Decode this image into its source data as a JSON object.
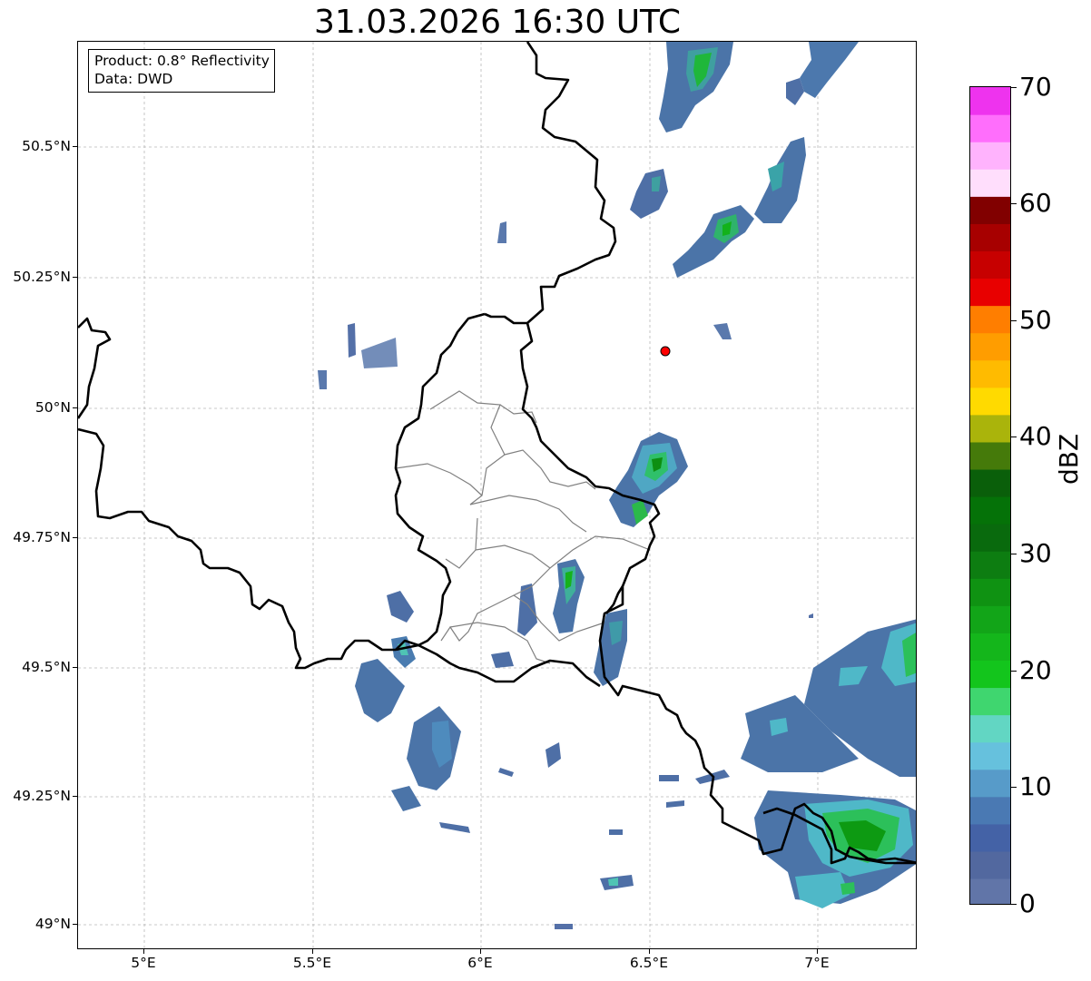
{
  "title": "31.03.2026 16:30 UTC",
  "info_box": {
    "product": "Product: 0.8° Reflectivity",
    "source": "Data: DWD"
  },
  "axes": {
    "lat_ticks": [
      "50.5°N",
      "50.25°N",
      "50°N",
      "49.75°N",
      "49.5°N",
      "49.25°N",
      "49°N"
    ],
    "lon_ticks": [
      "5°E",
      "5.5°E",
      "6°E",
      "6.5°E",
      "7°E"
    ]
  },
  "colorbar": {
    "unit": "dBZ",
    "tick_labels": [
      "0",
      "10",
      "20",
      "30",
      "40",
      "50",
      "60",
      "70"
    ],
    "colors": [
      "#6175a8",
      "#52689f",
      "#4462a6",
      "#4a79b3",
      "#579bc9",
      "#66c1dd",
      "#62d6c3",
      "#3fd66f",
      "#13c51c",
      "#14b61b",
      "#12a518",
      "#0f9212",
      "#0d7d11",
      "#096a0d",
      "#057208",
      "#0a5f0a",
      "#457a0a",
      "#aab40b",
      "#ffda00",
      "#ffbb00",
      "#ff9d00",
      "#ff7e00",
      "#e80000",
      "#c70000",
      "#a70000",
      "#810000",
      "#ffdefc",
      "#ffb3fd",
      "#ff6efc",
      "#ee33ee"
    ]
  },
  "map": {
    "radar_site_color": "#ff0000",
    "border_color": "#000000",
    "district_color": "#808080"
  }
}
